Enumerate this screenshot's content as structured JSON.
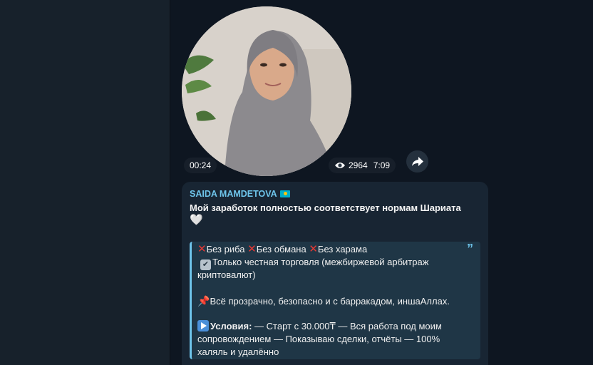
{
  "video": {
    "duration": "00:24",
    "views": "2964",
    "time": "7:09"
  },
  "message": {
    "sender": "SAIDA MAMDETOVA",
    "headline": "Мой заработок полностью соответствует нормам Шариата",
    "heart": "🤍",
    "quote": {
      "mark": "”",
      "item1": "Без риба",
      "item2": "Без обмана",
      "item3": "Без харама",
      "line2": "Только честная торговля (межбиржевой арбитраж",
      "line3": "криптовалют)",
      "line4": "Всё прозрачно, безопасно и с барракадом, иншаАллах.",
      "conditions_label": "Условия:",
      "line5_rest": " — Старт с 30.000₸ — Вся работа под моим",
      "line6": "сопровождением — Показываю сделки, отчёты — 100%",
      "line7": "халяль и удалённо"
    }
  },
  "colors": {
    "accent": "#6ec4ea",
    "background": "#0e1621",
    "bubble": "#182533",
    "quote_bg": "#1f3646"
  },
  "icons": {
    "eye": "eye-icon",
    "share": "share-icon",
    "flag": "kazakhstan-flag-icon",
    "cross": "cross-mark-icon",
    "check": "check-box-icon",
    "pin": "pushpin-icon",
    "play": "play-button-icon"
  }
}
